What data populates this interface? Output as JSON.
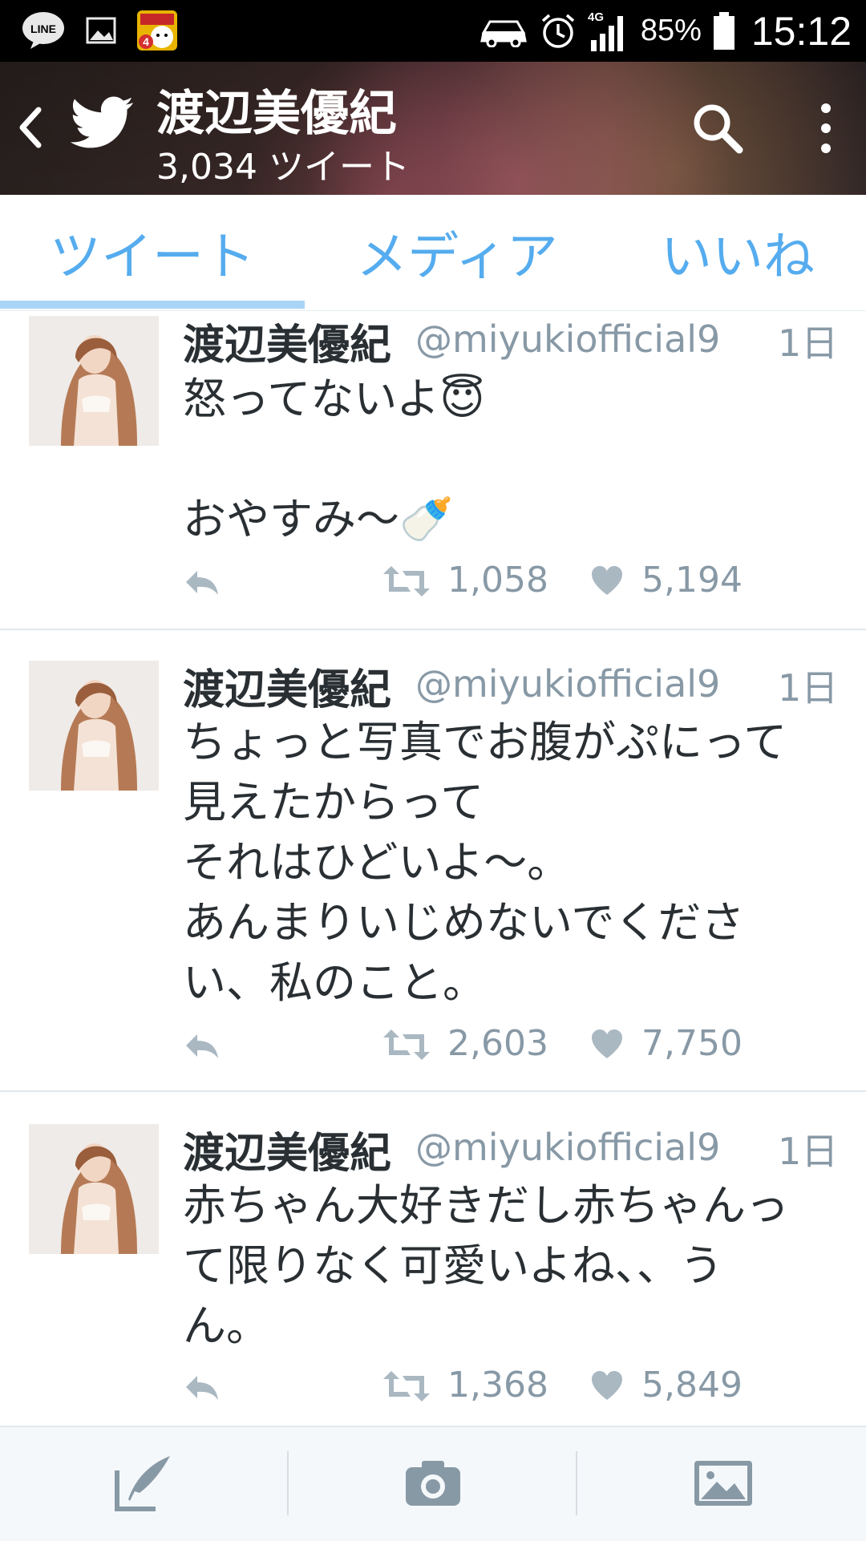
{
  "status_bar": {
    "battery_percent": "85%",
    "time": "15:12",
    "network": "4G",
    "icons": [
      "line-app-icon",
      "gallery-notification-icon",
      "game-notification-icon",
      "car-icon",
      "alarm-icon",
      "signal-icon",
      "battery-icon"
    ]
  },
  "header": {
    "title": "渡辺美優紀",
    "tweet_count": "3,034 ツイート"
  },
  "tabs": [
    {
      "label": "ツイート",
      "active": true
    },
    {
      "label": "メディア",
      "active": false
    },
    {
      "label": "いいね",
      "active": false
    }
  ],
  "tweets": [
    {
      "name": "渡辺美優紀",
      "handle": "@miyukiofficial9",
      "time": "1日",
      "text": "怒ってないよ😇\n\nおやすみ〜🍼",
      "retweets": "1,058",
      "likes": "5,194"
    },
    {
      "name": "渡辺美優紀",
      "handle": "@miyukiofficial9",
      "time": "1日",
      "text": "ちょっと写真でお腹がぷにって\n見えたからって\nそれはひどいよ〜。\nあんまりいじめないでくださ\nい、私のこと。",
      "retweets": "2,603",
      "likes": "7,750"
    },
    {
      "name": "渡辺美優紀",
      "handle": "@miyukiofficial9",
      "time": "1日",
      "text": "赤ちゃん大好きだし赤ちゃんっ\nて限りなく可愛いよね、、う\nん。",
      "retweets": "1,368",
      "likes": "5,849"
    }
  ],
  "colors": {
    "accent": "#55acee",
    "text": "#292f33",
    "muted": "#8899a6"
  }
}
